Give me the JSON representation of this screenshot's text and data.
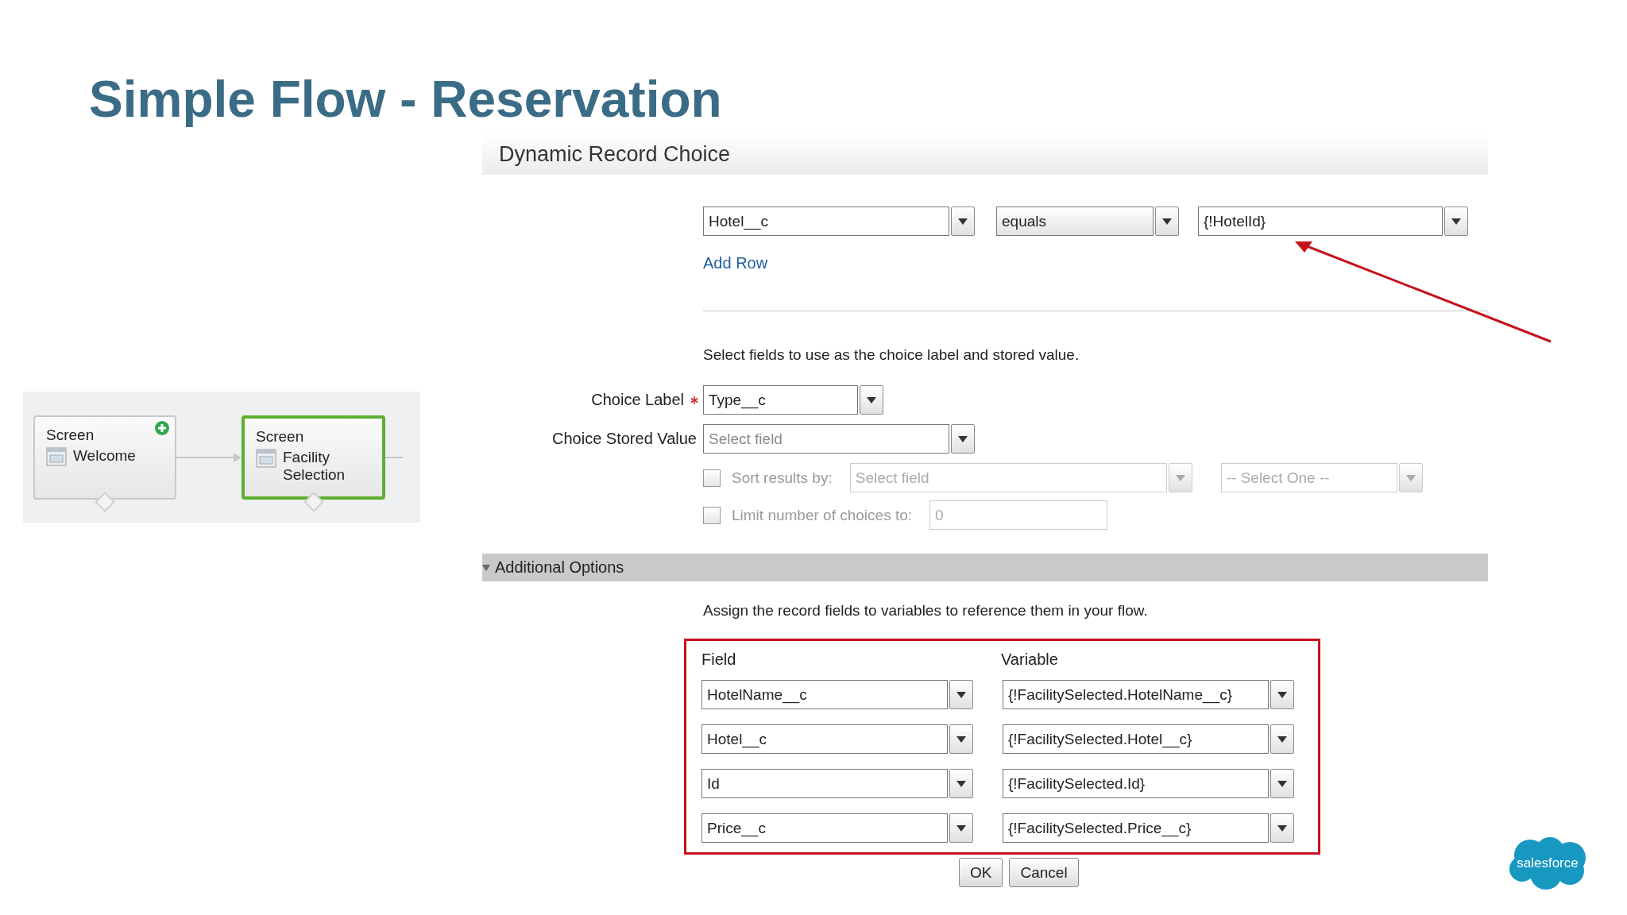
{
  "slide": {
    "title": "Simple Flow - Reservation"
  },
  "flow": {
    "nodes": [
      {
        "type": "Screen",
        "label": "Welcome",
        "selected": false,
        "start": true
      },
      {
        "type": "Screen",
        "label": "Facility Selection",
        "selected": true,
        "start": false
      }
    ]
  },
  "dialog": {
    "title": "Dynamic Record Choice",
    "filter": {
      "field": "Hotel__c",
      "operator": "equals",
      "value": "{!HotelId}"
    },
    "add_row": "Add Row",
    "choice_hint": "Select fields to use as the choice label and stored value.",
    "choice_label": {
      "label": "Choice Label",
      "value": "Type__c",
      "required": true
    },
    "stored_value": {
      "label": "Choice Stored Value",
      "placeholder": "Select field"
    },
    "sort": {
      "label": "Sort results by:",
      "checked": false,
      "disabled": true,
      "placeholder": "Select field",
      "order": "-- Select One --"
    },
    "limit": {
      "label": "Limit number of choices to:",
      "checked": false,
      "disabled": true,
      "value": "0"
    },
    "additional": {
      "title": "Additional Options",
      "expanded": true,
      "hint": "Assign the record fields to variables to reference them in your flow.",
      "columns": [
        "Field",
        "Variable"
      ],
      "rows": [
        {
          "field": "HotelName__c",
          "variable": "{!FacilitySelected.HotelName__c}"
        },
        {
          "field": "Hotel__c",
          "variable": "{!FacilitySelected.Hotel__c}"
        },
        {
          "field": "Id",
          "variable": "{!FacilitySelected.Id}"
        },
        {
          "field": "Price__c",
          "variable": "{!FacilitySelected.Price__c}"
        }
      ]
    },
    "buttons": [
      "OK",
      "Cancel"
    ]
  },
  "logo": {
    "text": "salesforce"
  }
}
